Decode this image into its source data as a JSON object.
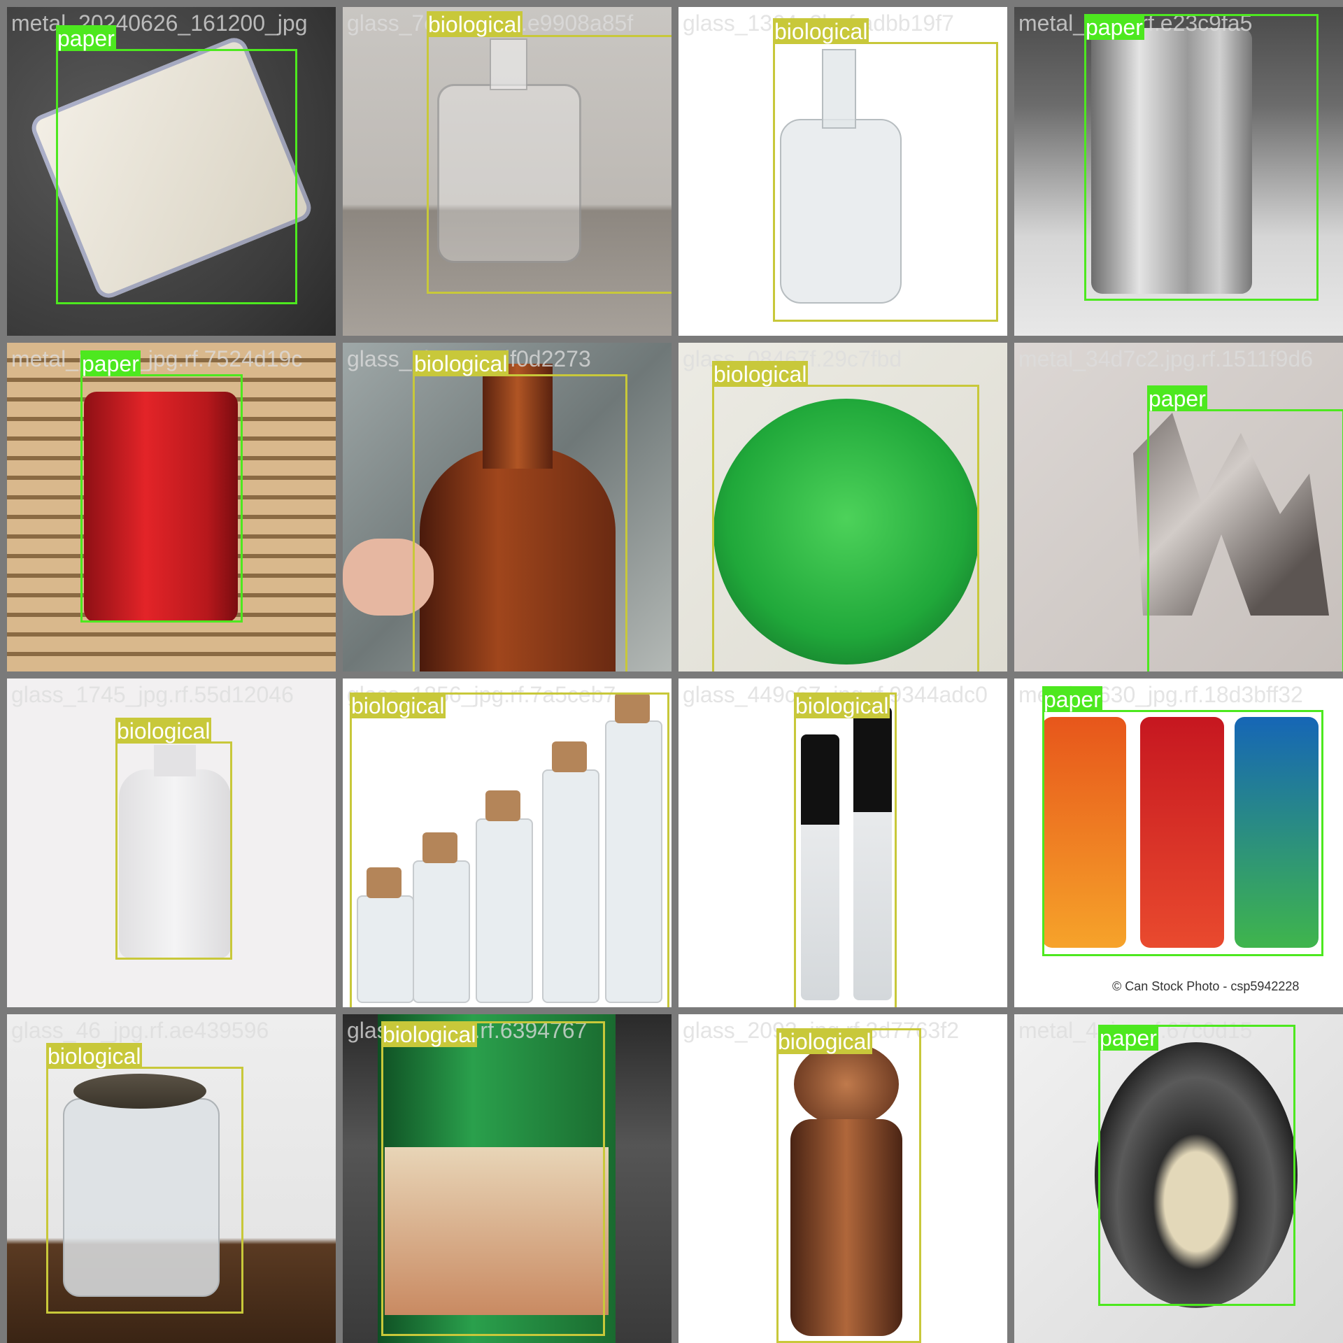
{
  "colors": {
    "paper": "#4de81f",
    "biological": "#c8c83a",
    "border": "#7a7a7a"
  },
  "tiles": [
    {
      "filename": "metal_20240626_161200_jpg",
      "box_label": "paper",
      "class": "paper",
      "scene": "crushed-can"
    },
    {
      "filename": "glass_7c87e21c6.e9908a85f",
      "box_label": "biological",
      "class": "biological",
      "scene": "flask-bottle"
    },
    {
      "filename": "glass_1364_3b.rf.adbb19f7",
      "box_label": "biological",
      "class": "biological",
      "scene": "jug-bottle"
    },
    {
      "filename": "metal_1.jpg.rf.e23c9fa5",
      "box_label": "paper",
      "class": "paper",
      "scene": "silver-can"
    },
    {
      "filename": "metal_paper_jpg.rf.7524d19c",
      "box_label": "paper",
      "class": "paper",
      "scene": "coke-can"
    },
    {
      "filename": "glass_9b37a6cdf0d2273",
      "box_label": "biological",
      "class": "biological",
      "scene": "brown-bottle"
    },
    {
      "filename": "glass_08467f.29c7fbd",
      "box_label": "biological",
      "class": "biological",
      "scene": "green-glass"
    },
    {
      "filename": "metal_34d7c2.jpg.rf.1511f9d6",
      "box_label": "paper",
      "class": "paper",
      "scene": "metal-piece"
    },
    {
      "filename": "glass_1745_jpg.rf.55d12046",
      "box_label": "biological",
      "class": "biological",
      "scene": "frosted-bottle"
    },
    {
      "filename": "glass_1856_jpg.rf.7a5ceb7",
      "box_label": "biological",
      "class": "biological",
      "scene": "cork-vials"
    },
    {
      "filename": "glass_449c67_jpg.rf.9344adc0",
      "box_label": "biological",
      "class": "biological",
      "scene": "tube-vials"
    },
    {
      "filename": "metal_2630_jpg.rf.18d3bff32",
      "box_label": "paper",
      "class": "paper",
      "scene": "three-cans",
      "watermark": "© Can Stock Photo - csp5942228"
    },
    {
      "filename": "glass_46_jpg.rf.ae439596",
      "box_label": "biological",
      "class": "biological",
      "scene": "glass-jar"
    },
    {
      "filename": "glass_bb62b.rf.6394767",
      "box_label": "biological",
      "class": "biological",
      "scene": "beer-bottle"
    },
    {
      "filename": "glass_2093_jpg.rf.3d7763f2",
      "box_label": "biological",
      "class": "biological",
      "scene": "ornate-bottle"
    },
    {
      "filename": "metal_4_jpg.rf.67c0d15",
      "box_label": "paper",
      "class": "paper",
      "scene": "can-top"
    }
  ]
}
